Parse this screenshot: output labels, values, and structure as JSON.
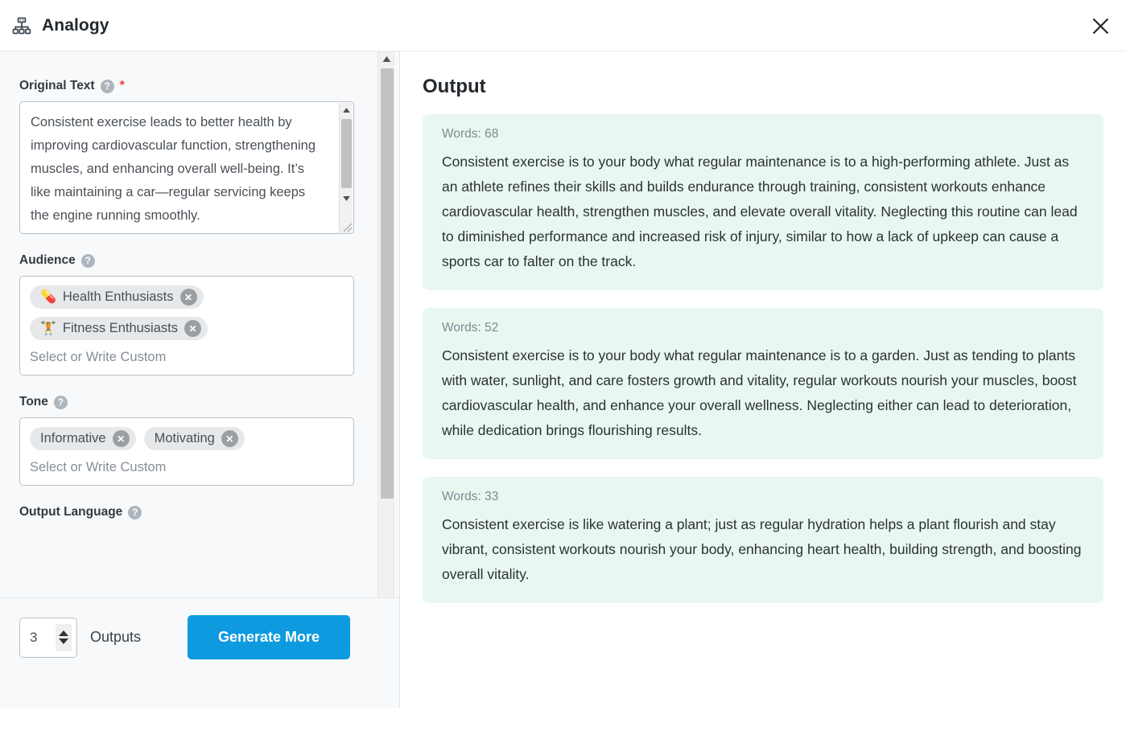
{
  "header": {
    "title": "Analogy",
    "icon": "sitemap-icon",
    "close_icon": "close-icon"
  },
  "form": {
    "original_text": {
      "label": "Original Text",
      "required_marker": "*",
      "help_icon": "help-icon",
      "value": "Consistent exercise leads to better health by improving cardiovascular function, strengthening muscles, and enhancing overall well-being. It’s like maintaining a car—regular servicing keeps the engine running smoothly."
    },
    "audience": {
      "label": "Audience",
      "help_icon": "help-icon",
      "placeholder": "Select or Write Custom",
      "tags": [
        {
          "emoji": "💊",
          "label": "Health Enthusiasts",
          "remove_icon": "remove-tag-icon"
        },
        {
          "emoji": "🏋️",
          "label": "Fitness Enthusiasts",
          "remove_icon": "remove-tag-icon"
        }
      ]
    },
    "tone": {
      "label": "Tone",
      "help_icon": "help-icon",
      "placeholder": "Select or Write Custom",
      "tags": [
        {
          "label": "Informative",
          "remove_icon": "remove-tag-icon"
        },
        {
          "label": "Motivating",
          "remove_icon": "remove-tag-icon"
        }
      ]
    },
    "output_language": {
      "label": "Output Language",
      "help_icon": "help-icon"
    }
  },
  "action_bar": {
    "outputs_count": "3",
    "outputs_label": "Outputs",
    "generate_label": "Generate More",
    "generate_color": "#0d9ade"
  },
  "output": {
    "title": "Output",
    "card_color": "#e9f7f1",
    "cards": [
      {
        "words_label": "Words: 68",
        "text": "Consistent exercise is to your body what regular maintenance is to a high-performing athlete. Just as an athlete refines their skills and builds endurance through training, consistent workouts enhance cardiovascular health, strengthen muscles, and elevate overall vitality. Neglecting this routine can lead to diminished performance and increased risk of injury, similar to how a lack of upkeep can cause a sports car to falter on the track."
      },
      {
        "words_label": "Words: 52",
        "text": "Consistent exercise is to your body what regular maintenance is to a garden. Just as tending to plants with water, sunlight, and care fosters growth and vitality, regular workouts nourish your muscles, boost cardiovascular health, and enhance your overall wellness. Neglecting either can lead to deterioration, while dedication brings flourishing results."
      },
      {
        "words_label": "Words: 33",
        "text": "Consistent exercise is like watering a plant; just as regular hydration helps a plant flourish and stay vibrant, consistent workouts nourish your body, enhancing heart health, building strength, and boosting overall vitality."
      }
    ]
  }
}
